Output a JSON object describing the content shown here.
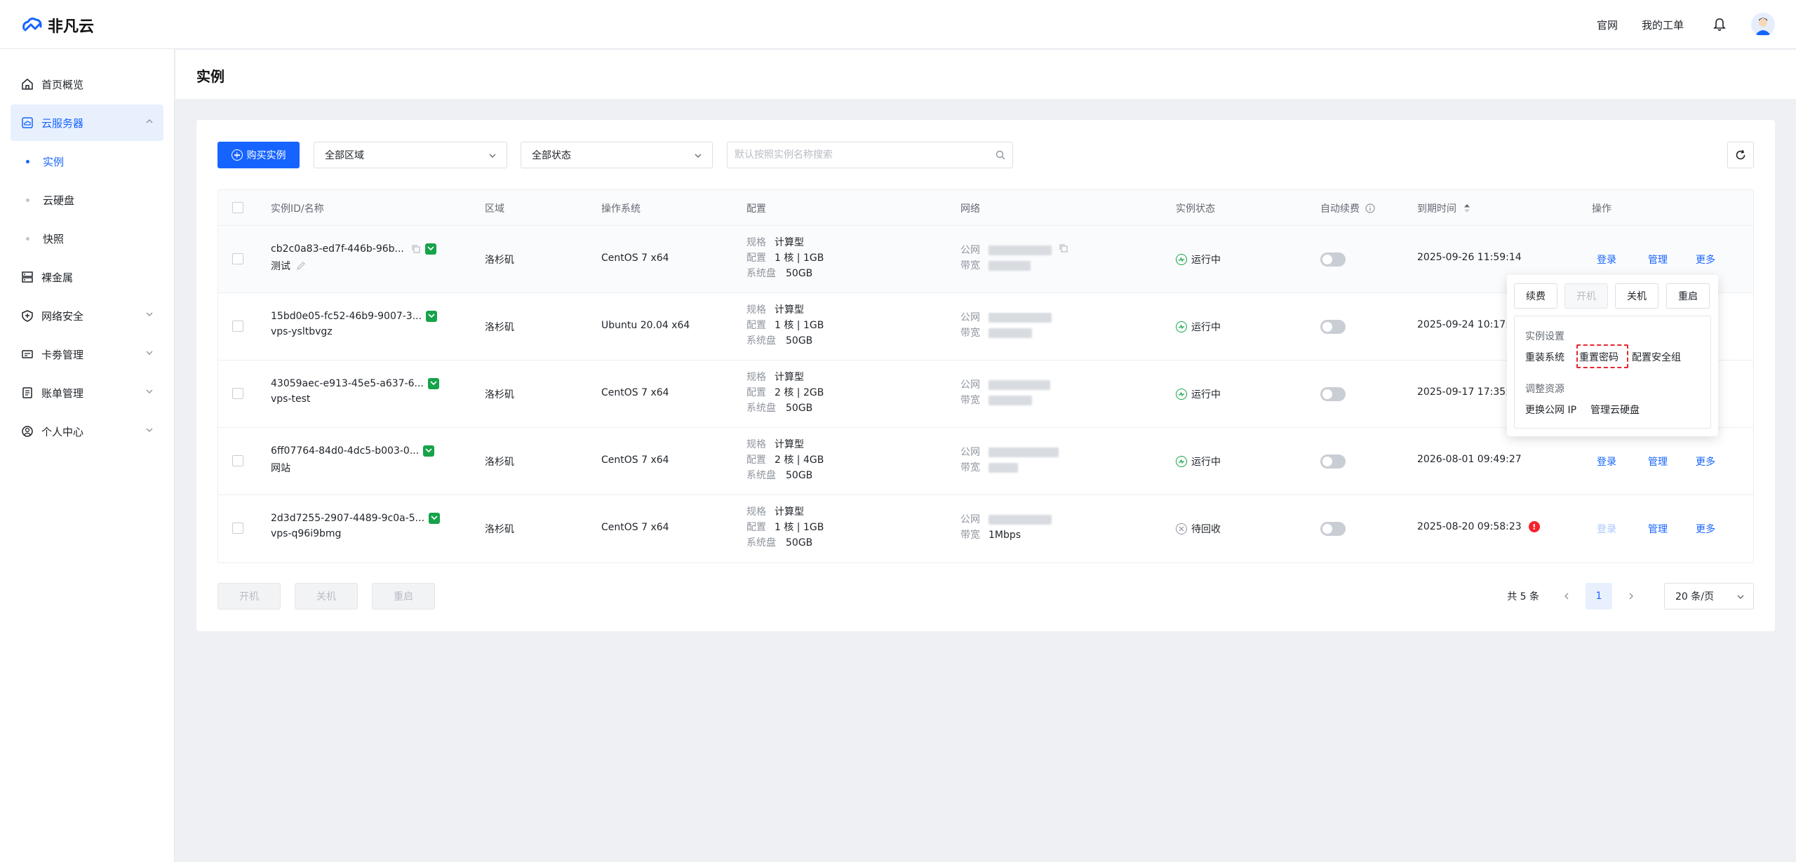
{
  "header": {
    "brand": "非凡云",
    "links": [
      "官网",
      "我的工单"
    ]
  },
  "sidebar": {
    "items": [
      {
        "label": "首页概览",
        "icon": "home-icon"
      },
      {
        "label": "云服务器",
        "icon": "cloud-server-icon",
        "active": true
      },
      {
        "label": "实例",
        "sub": true,
        "active": true
      },
      {
        "label": "云硬盘",
        "sub": true
      },
      {
        "label": "快照",
        "sub": true
      },
      {
        "label": "裸金属",
        "icon": "server-icon"
      },
      {
        "label": "网络安全",
        "icon": "shield-icon"
      },
      {
        "label": "卡劵管理",
        "icon": "card-icon"
      },
      {
        "label": "账单管理",
        "icon": "bill-icon"
      },
      {
        "label": "个人中心",
        "icon": "user-icon"
      }
    ]
  },
  "page": {
    "title": "实例"
  },
  "toolbar": {
    "buy_label": "购买实例",
    "region_select": "全部区域",
    "status_select": "全部状态",
    "search_placeholder": "默认按照实例名称搜索"
  },
  "table": {
    "headers": [
      "实例ID/名称",
      "区域",
      "操作系统",
      "配置",
      "网络",
      "实例状态",
      "自动续费",
      "到期时间",
      "操作"
    ],
    "cfg_keys": {
      "spec": "规格",
      "config": "配置",
      "disk": "系统盘"
    },
    "net_keys": {
      "public": "公网",
      "bandwidth": "带宽"
    },
    "actions": {
      "login": "登录",
      "manage": "管理",
      "more": "更多"
    },
    "rows": [
      {
        "id": "cb2c0a83-ed7f-446b-96b...",
        "name": "测试",
        "region": "洛杉矶",
        "os": "CentOS 7 x64",
        "spec": "计算型",
        "config": "1 核 | 1GB",
        "disk": "50GB",
        "bandwidth": "",
        "status": "运行中",
        "status_type": "running",
        "expire": "2025-09-26 11:59:14",
        "warn": false
      },
      {
        "id": "15bd0e05-fc52-46b9-9007-3...",
        "name": "vps-ysltbvgz",
        "region": "洛杉矶",
        "os": "Ubuntu 20.04 x64",
        "spec": "计算型",
        "config": "1 核 | 1GB",
        "disk": "50GB",
        "bandwidth": "",
        "status": "运行中",
        "status_type": "running",
        "expire": "2025-09-24 10:17:",
        "warn": false
      },
      {
        "id": "43059aec-e913-45e5-a637-6...",
        "name": "vps-test",
        "region": "洛杉矶",
        "os": "CentOS 7 x64",
        "spec": "计算型",
        "config": "2 核 | 2GB",
        "disk": "50GB",
        "bandwidth": "",
        "status": "运行中",
        "status_type": "running",
        "expire": "2025-09-17 17:35:",
        "warn": false
      },
      {
        "id": "6ff07764-84d0-4dc5-b003-0...",
        "name": "网站",
        "region": "洛杉矶",
        "os": "CentOS 7 x64",
        "spec": "计算型",
        "config": "2 核 | 4GB",
        "disk": "50GB",
        "bandwidth": "",
        "status": "运行中",
        "status_type": "running",
        "expire": "2026-08-01 09:49:27",
        "warn": false
      },
      {
        "id": "2d3d7255-2907-4489-9c0a-5...",
        "name": "vps-q96i9bmg",
        "region": "洛杉矶",
        "os": "CentOS 7 x64",
        "spec": "计算型",
        "config": "1 核 | 1GB",
        "disk": "50GB",
        "bandwidth": "1Mbps",
        "status": "待回收",
        "status_type": "recycle",
        "expire": "2025-08-20 09:58:23",
        "warn": true
      }
    ]
  },
  "bottom": {
    "power_on": "开机",
    "power_off": "关机",
    "reboot": "重启"
  },
  "pager": {
    "total": "共 5 条",
    "current": "1",
    "page_size": "20 条/页"
  },
  "popover": {
    "buttons": [
      "续费",
      "开机",
      "关机",
      "重启"
    ],
    "section1": "实例设置",
    "section1_items": [
      "重装系统",
      "重置密码",
      "配置安全组"
    ],
    "section2": "调整资源",
    "section2_items": [
      "更换公网 IP",
      "管理云硬盘"
    ]
  },
  "colors": {
    "primary": "#1664ff",
    "running": "#16a34a",
    "warn": "#f5222d",
    "highlight": "#e5262f"
  }
}
